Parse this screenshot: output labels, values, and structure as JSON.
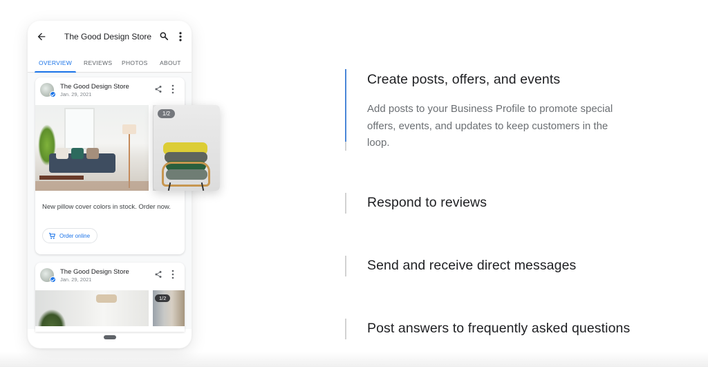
{
  "phone": {
    "app_title": "The Good Design Store",
    "icons": {
      "back": "arrow-back-icon",
      "search": "search-icon",
      "more": "more-vert-icon"
    },
    "tabs": [
      {
        "label": "OVERVIEW",
        "active": true
      },
      {
        "label": "REVIEWS",
        "active": false
      },
      {
        "label": "PHOTOS",
        "active": false
      },
      {
        "label": "ABOUT",
        "active": false
      }
    ],
    "posts": [
      {
        "store_name": "The Good Design Store",
        "date": "Jan. 29, 2021",
        "photo_counter": "1/2",
        "text": "New pillow cover colors in stock. Order now.",
        "action_label": "Order online"
      },
      {
        "store_name": "The Good Design Store",
        "date": "Jan. 29, 2021",
        "photo_counter": "1/2"
      }
    ],
    "floating_photo_counter": "1/2"
  },
  "features": [
    {
      "title": "Create posts, offers, and events",
      "description": "Add posts to your Business Profile to promote special offers, events, and updates to keep customers in the loop.",
      "active": true,
      "progress": 0.89
    },
    {
      "title": "Respond to reviews",
      "active": false,
      "progress": 0
    },
    {
      "title": "Send and receive direct messages",
      "active": false,
      "progress": 0
    },
    {
      "title": "Post answers to frequently asked questions",
      "active": false,
      "progress": 0
    }
  ],
  "colors": {
    "accent": "#1a73e8",
    "progress_fill": "#4a86d8",
    "progress_track": "#d2d2d2",
    "title_text": "#202124",
    "body_text": "#6b6f73"
  }
}
